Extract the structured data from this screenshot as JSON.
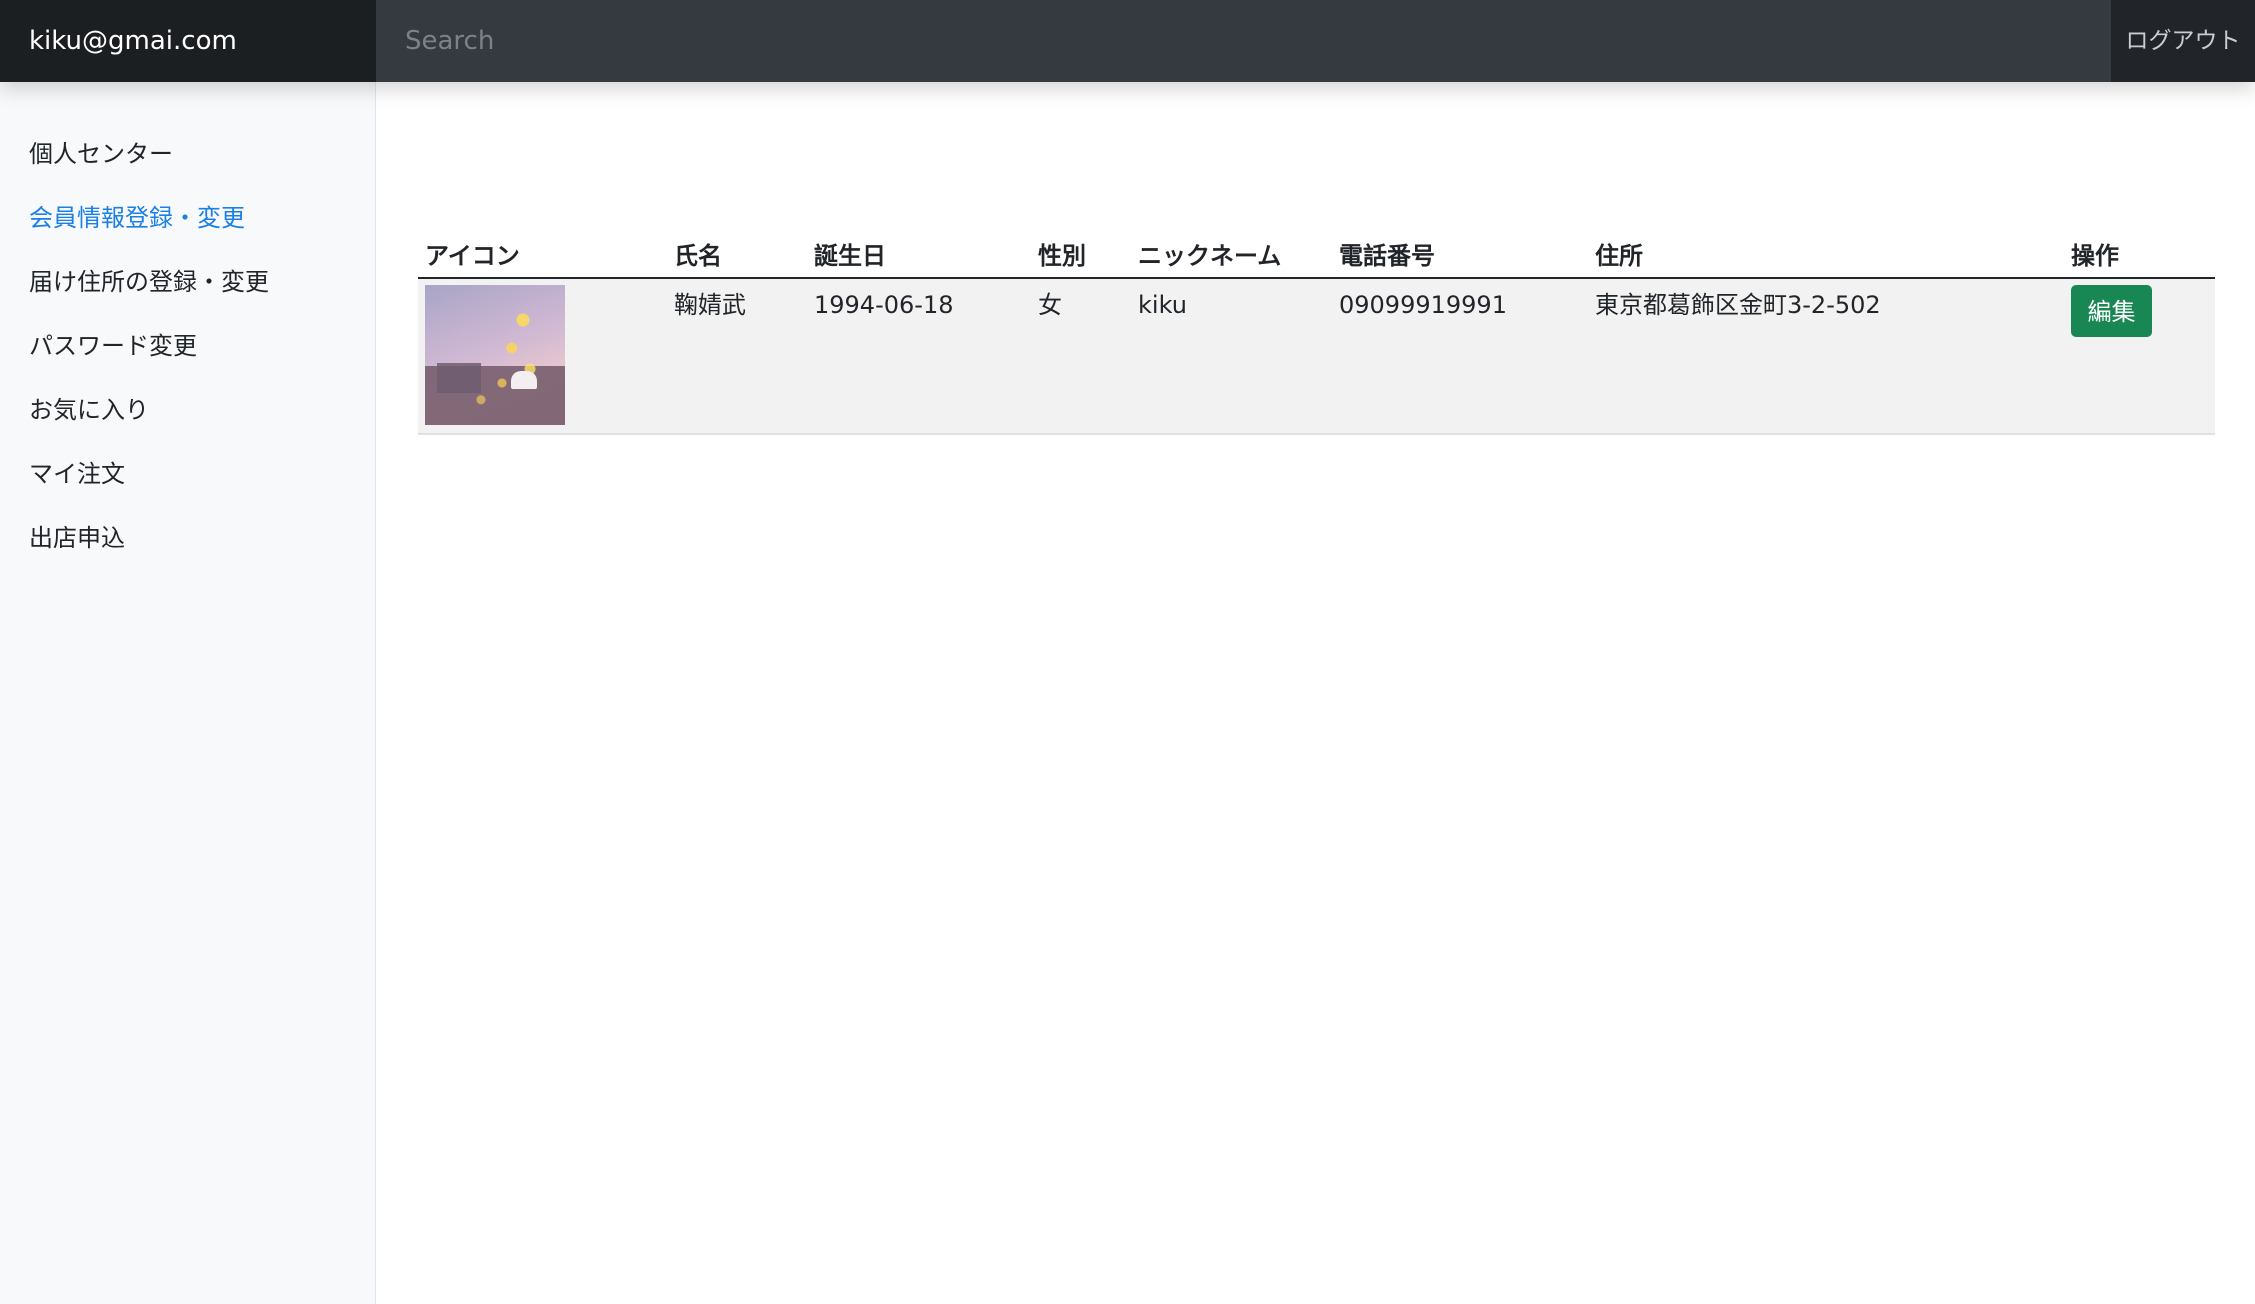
{
  "header": {
    "user_email": "kiku@gmai.com",
    "search_placeholder": "Search",
    "logout_label": "ログアウト"
  },
  "sidebar": {
    "items": [
      {
        "label": "個人センター",
        "active": false
      },
      {
        "label": "会員情報登録・変更",
        "active": true
      },
      {
        "label": "届け住所の登録・変更",
        "active": false
      },
      {
        "label": "パスワード変更",
        "active": false
      },
      {
        "label": "お気に入り",
        "active": false
      },
      {
        "label": "マイ注文",
        "active": false
      },
      {
        "label": "出店申込",
        "active": false
      }
    ]
  },
  "table": {
    "columns": [
      "アイコン",
      "氏名",
      "誕生日",
      "性別",
      "ニックネーム",
      "電話番号",
      "住所",
      "操作"
    ],
    "rows": [
      {
        "name": "鞠婧武",
        "birthday": "1994-06-18",
        "gender": "女",
        "nickname": "kiku",
        "phone": "09099919991",
        "address": "東京都葛飾区金町3-2-502",
        "action_label": "編集"
      }
    ]
  },
  "colors": {
    "topbar": "#343a40",
    "brand_bg": "#1c1f22",
    "active_link": "#1a7fe6",
    "edit_button": "#198754"
  }
}
